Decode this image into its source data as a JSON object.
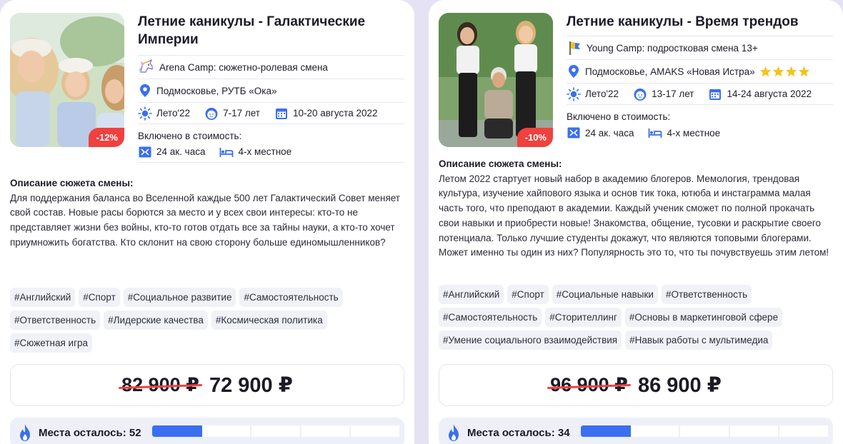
{
  "colors": {
    "accent": "#3a6ff0",
    "discount": "#f0413f",
    "star": "#f6c21a",
    "tag_bg": "#f1f2f7"
  },
  "cards": [
    {
      "discount": "-12%",
      "title": "Летние каникулы - Галактические Империи",
      "camp": {
        "icon": "unicorn-icon",
        "label": "Arena Camp: сюжетно-ролевая смена"
      },
      "location": "Подмосковье, РУТБ «Ока»",
      "season": "Лето'22",
      "age": "7-17 лет",
      "dates": "10-20 августа 2022",
      "included_label": "Включено в стоимость:",
      "hours": "24 ак. часа",
      "room": "4-х местное",
      "desc_title": "Описание сюжета смены:",
      "description": "Для поддержания баланса во Вселенной каждые 500 лет Галактический Совет меняет свой состав. Новые расы борются за место и у всех свои интересы: кто-то не представляет жизни без войны, кто-то готов отдать все за тайны науки, а кто-то хочет приумножить богатства. Кто склонит на свою сторону больше единомышленников?",
      "tags": [
        "#Английский",
        "#Спорт",
        "#Социальное развитие",
        "#Самостоятельность",
        "#Ответственность",
        "#Лидерские качества",
        "#Космическая политика",
        "#Сюжетная игра"
      ],
      "old_price": "82 900 ₽",
      "new_price": "72 900 ₽",
      "places_label": "Места осталось: 52",
      "places_fill": 0.2
    },
    {
      "discount": "-10%",
      "title": "Летние каникулы - Время трендов",
      "camp": {
        "icon": "flag-icon",
        "label": "Young Camp: подростковая смена 13+"
      },
      "location": "Подмосковье, AMAKS «Новая Истра»",
      "stars": 4,
      "season": "Лето'22",
      "age": "13-17 лет",
      "dates": "14-24 августа 2022",
      "included_label": "Включено в стоимость:",
      "hours": "24 ак. часа",
      "room": "4-х местное",
      "desc_title": "Описание сюжета смены:",
      "description": "Летом 2022 стартует новый набор в академию блогеров. Мемология, трендовая культура, изучение хайпового языка и основ тик тока, ютюба и инстаграмма малая часть того, что преподают в академии. Каждый ученик сможет по полной прокачать свои навыки и приобрести новые! Знакомства, общение, тусовки и раскрытие своего потенциала. Только лучшие студенты докажут, что являются топовыми блогерами. Может именно ты один из них? Популярность это то, что ты почувствуешь этим летом!",
      "tags": [
        "#Английский",
        "#Спорт",
        "#Социальные навыки",
        "#Ответственность",
        "#Самостоятельность",
        "#Сторителлинг",
        "#Основы в маркетинговой сфере",
        "#Умение социального взаимодействия",
        "#Навык работы с мультимедиа"
      ],
      "old_price": "96 900 ₽",
      "new_price": "86 900 ₽",
      "places_label": "Места осталось: 34",
      "places_fill": 0.2
    }
  ]
}
